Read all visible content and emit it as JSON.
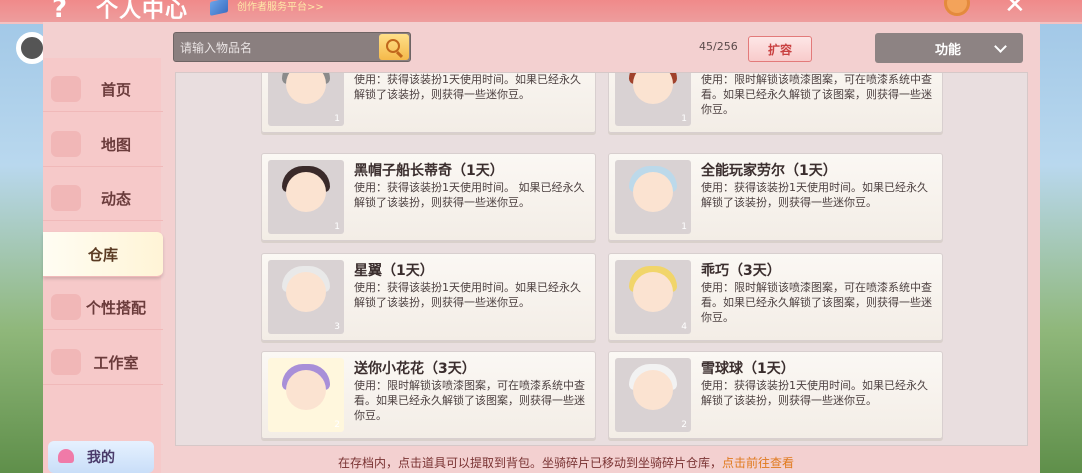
{
  "header": {
    "title": "个人中心",
    "link": "创作者服务平台>>"
  },
  "sidebar": {
    "items": [
      {
        "label": "首页",
        "icon": "home-icon"
      },
      {
        "label": "地图",
        "icon": "map-icon"
      },
      {
        "label": "动态",
        "icon": "bell-icon"
      },
      {
        "label": "仓库",
        "icon": "warehouse-icon",
        "active": true
      },
      {
        "label": "个性搭配",
        "icon": "outfit-icon"
      },
      {
        "label": "工作室",
        "icon": "studio-icon"
      }
    ],
    "me_label": "我的"
  },
  "toolbar": {
    "search_placeholder": "请输入物品名",
    "capacity": "45/256",
    "expand_label": "扩容",
    "function_label": "功能"
  },
  "items": [
    {
      "name": "",
      "desc": "使用：获得该装扮1天使用时间。如果已经永久解锁了该装扮，则获得一些迷你豆。",
      "count": "1"
    },
    {
      "name": "",
      "desc": "使用：限时解锁该喷漆图案，可在喷漆系统中查看。如果已经永久解锁了该图案，则获得一些迷你豆。",
      "count": "1"
    },
    {
      "name": "黑帽子船长蒂奇（1天）",
      "desc": "使用：获得该装扮1天使用时间。 如果已经永久解锁了该装扮，则获得一些迷你豆。",
      "count": "1"
    },
    {
      "name": "全能玩家劳尔（1天）",
      "desc": "使用：获得该装扮1天使用时间。如果已经永久解锁了该装扮，则获得一些迷你豆。",
      "count": "1"
    },
    {
      "name": "星翼（1天）",
      "desc": "使用：获得该装扮1天使用时间。如果已经永久解锁了该装扮，则获得一些迷你豆。",
      "count": "3"
    },
    {
      "name": "乖巧（3天）",
      "desc": "使用：限时解锁该喷漆图案，可在喷漆系统中查看。如果已经永久解锁了该图案，则获得一些迷你豆。",
      "count": "4"
    },
    {
      "name": "送你小花花（3天）",
      "desc": "使用：限时解锁该喷漆图案，可在喷漆系统中查看。如果已经永久解锁了该图案，则获得一些迷你豆。",
      "count": "2"
    },
    {
      "name": "雪球球（1天）",
      "desc": "使用：获得该装扮1天使用时间。如果已经永久解锁了该装扮，则获得一些迷你豆。",
      "count": "2"
    }
  ],
  "footer": {
    "text": "在存档内，点击道具可以提取到背包。坐骑碎片已移动到坐骑碎片仓库，",
    "link": "点击前往查看"
  },
  "colors": {
    "accent_pink": "#ee9d9d",
    "link_orange": "#e07a1e",
    "button_red": "#c94040"
  }
}
